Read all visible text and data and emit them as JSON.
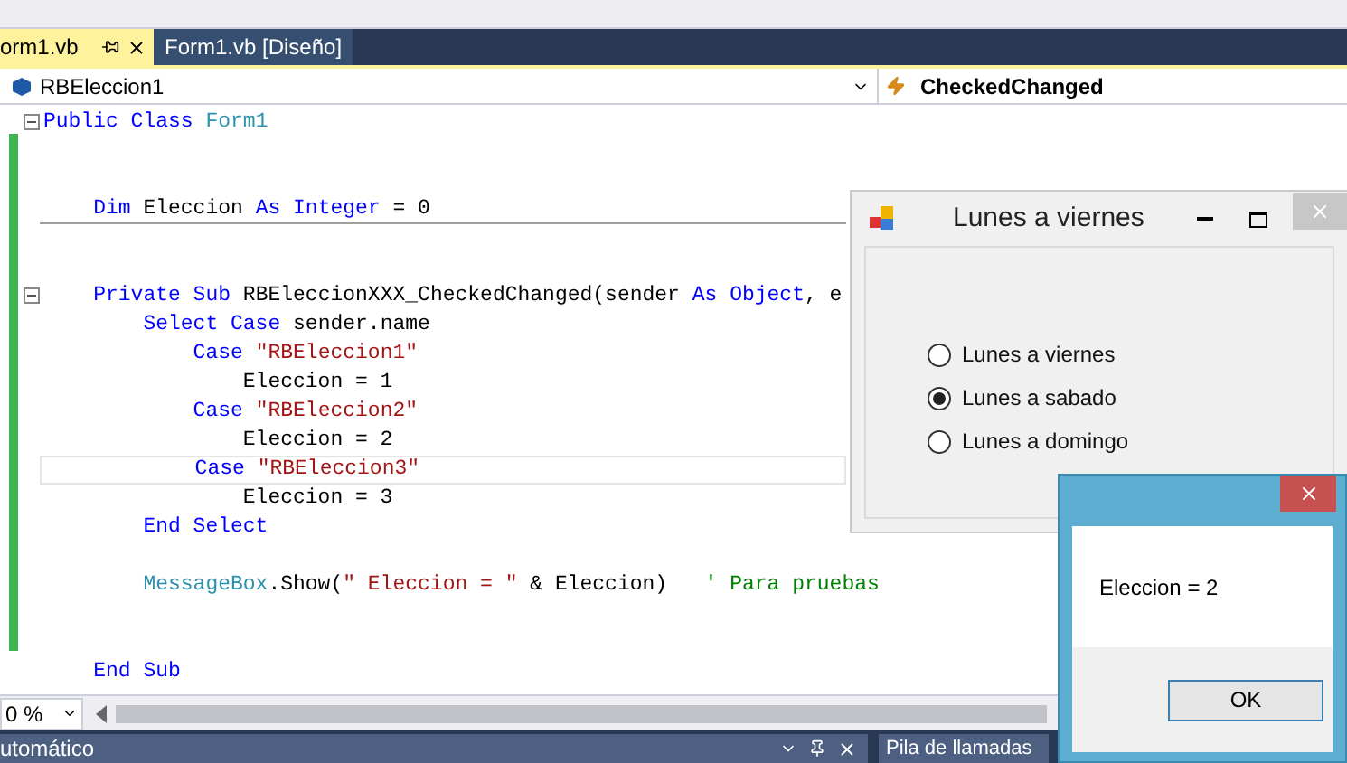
{
  "editor_tabs": [
    {
      "label": "orm1.vb",
      "selected": true
    },
    {
      "label": "Form1.vb [Diseño]",
      "selected": false
    }
  ],
  "navigation": {
    "object": "RBEleccion1",
    "event": "CheckedChanged"
  },
  "code": {
    "lines": [
      {
        "kind": "code",
        "foldable": true,
        "current": false,
        "separator": false,
        "tokens": [
          {
            "kind": "keyword",
            "text": "Public Class "
          },
          {
            "kind": "type",
            "text": "Form1"
          }
        ],
        "children": [
          {
            "kind": "blank"
          },
          {
            "kind": "blank"
          },
          {
            "kind": "code",
            "foldable": false,
            "current": false,
            "separator": true,
            "tokens": [
              {
                "kind": "keyword",
                "text": "Dim "
              },
              {
                "kind": "plain",
                "text": "Eleccion "
              },
              {
                "kind": "keyword",
                "text": "As Integer "
              },
              {
                "kind": "plain",
                "text": "= 0"
              }
            ]
          },
          {
            "kind": "blank"
          },
          {
            "kind": "blank"
          },
          {
            "kind": "code",
            "foldable": true,
            "current": false,
            "separator": false,
            "tokens": [
              {
                "kind": "keyword",
                "text": "Private Sub "
              },
              {
                "kind": "plain",
                "text": "RBEleccionXXX_CheckedChanged(sender "
              },
              {
                "kind": "keyword",
                "text": "As Object"
              },
              {
                "kind": "plain",
                "text": ", e"
              }
            ],
            "children": [
              {
                "kind": "code",
                "foldable": false,
                "current": false,
                "separator": false,
                "tokens": [
                  {
                    "kind": "keyword",
                    "text": "Select Case "
                  },
                  {
                    "kind": "plain",
                    "text": "sender.name"
                  }
                ],
                "children": [
                  {
                    "kind": "code",
                    "foldable": false,
                    "current": false,
                    "separator": false,
                    "tokens": [
                      {
                        "kind": "keyword",
                        "text": "Case "
                      },
                      {
                        "kind": "string",
                        "text": "\"RBEleccion1\""
                      }
                    ],
                    "children": [
                      {
                        "kind": "code",
                        "foldable": false,
                        "current": false,
                        "separator": false,
                        "tokens": [
                          {
                            "kind": "plain",
                            "text": "Eleccion = 1"
                          }
                        ]
                      }
                    ]
                  },
                  {
                    "kind": "code",
                    "foldable": false,
                    "current": false,
                    "separator": false,
                    "tokens": [
                      {
                        "kind": "keyword",
                        "text": "Case "
                      },
                      {
                        "kind": "string",
                        "text": "\"RBEleccion2\""
                      }
                    ],
                    "children": [
                      {
                        "kind": "code",
                        "foldable": false,
                        "current": false,
                        "separator": false,
                        "tokens": [
                          {
                            "kind": "plain",
                            "text": "Eleccion = 2"
                          }
                        ]
                      }
                    ]
                  },
                  {
                    "kind": "code",
                    "foldable": false,
                    "current": true,
                    "separator": false,
                    "tokens": [
                      {
                        "kind": "keyword",
                        "text": "Case "
                      },
                      {
                        "kind": "string",
                        "text": "\"RBEleccion3\""
                      }
                    ],
                    "children": [
                      {
                        "kind": "code",
                        "foldable": false,
                        "current": false,
                        "separator": false,
                        "tokens": [
                          {
                            "kind": "plain",
                            "text": "Eleccion = 3"
                          }
                        ]
                      }
                    ]
                  }
                ]
              },
              {
                "kind": "code",
                "foldable": false,
                "current": false,
                "separator": false,
                "tokens": [
                  {
                    "kind": "keyword",
                    "text": "End Select"
                  }
                ]
              },
              {
                "kind": "blank"
              },
              {
                "kind": "code",
                "foldable": false,
                "current": false,
                "separator": false,
                "tokens": [
                  {
                    "kind": "type",
                    "text": "MessageBox"
                  },
                  {
                    "kind": "plain",
                    "text": ".Show("
                  },
                  {
                    "kind": "string",
                    "text": "\" Eleccion = \""
                  },
                  {
                    "kind": "plain",
                    "text": " & Eleccion)   "
                  },
                  {
                    "kind": "comment",
                    "text": "' Para pruebas"
                  }
                ]
              },
              {
                "kind": "blank"
              },
              {
                "kind": "blank"
              }
            ]
          },
          {
            "kind": "code",
            "foldable": false,
            "current": false,
            "separator": false,
            "tokens": [
              {
                "kind": "keyword",
                "text": "End Sub"
              }
            ]
          }
        ]
      }
    ]
  },
  "zoom": "0 %",
  "bottom_panels": [
    {
      "title": "utomático"
    },
    {
      "title": "Pila de llamadas"
    }
  ],
  "form_window": {
    "title": "Lunes a viernes",
    "options": [
      {
        "label": "Lunes a viernes",
        "selected": false
      },
      {
        "label": "Lunes a sabado",
        "selected": true
      },
      {
        "label": "Lunes a domingo",
        "selected": false
      }
    ]
  },
  "message_box": {
    "text": "Eleccion = 2",
    "button": "OK"
  }
}
